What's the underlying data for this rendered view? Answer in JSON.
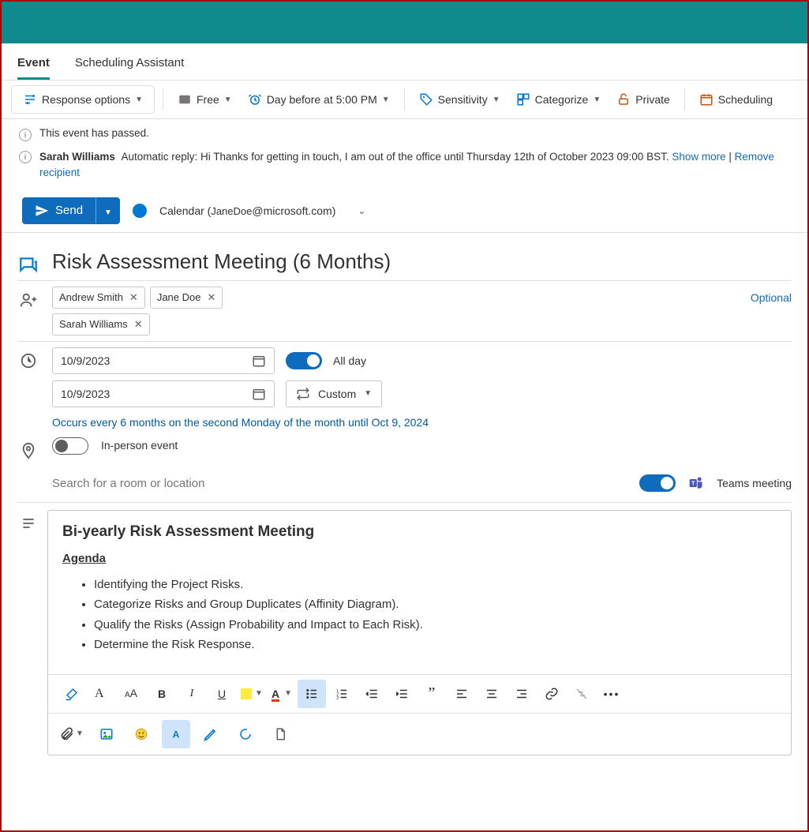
{
  "tabs": {
    "event": "Event",
    "scheduling": "Scheduling Assistant"
  },
  "toolbar": {
    "response": "Response options",
    "busy": "Free",
    "reminder": "Day before at 5:00 PM",
    "sensitivity": "Sensitivity",
    "categorize": "Categorize",
    "private": "Private",
    "scheduling": "Scheduling"
  },
  "banners": {
    "passed": "This event has passed.",
    "auto_reply_name": "Sarah Williams",
    "auto_reply_text": "Automatic reply: Hi Thanks for getting in touch, I am out of the office until Thursday 12th of October 2023 09:00 BST.",
    "show_more": "Show more",
    "sep": " | ",
    "remove": "Remove recipient"
  },
  "send": {
    "label": "Send",
    "calendar_prefix": "Calendar (",
    "calendar_user": "JaneDoe",
    "calendar_suffix": "@microsoft.com)"
  },
  "title": "Risk Assessment Meeting (6 Months)",
  "attendees": {
    "required": [
      "Andrew Smith",
      "Jane Doe"
    ],
    "second_row": [
      "Sarah Williams"
    ],
    "optional_label": "Optional"
  },
  "dates": {
    "start": "10/9/2023",
    "end": "10/9/2023",
    "all_day": "All day",
    "recur_btn": "Custom",
    "recurrence": "Occurs every 6 months on the second Monday of the month until Oct 9, 2024"
  },
  "location": {
    "inperson": "In-person event",
    "placeholder": "Search for a room or location",
    "teams": "Teams meeting"
  },
  "description": {
    "heading": "Bi-yearly Risk Assessment Meeting",
    "agenda_label": "Agenda",
    "items": [
      "Identifying the Project Risks.",
      "Categorize Risks and Group Duplicates (Affinity Diagram).",
      "Qualify the Risks (Assign Probability and Impact to Each Risk).",
      "Determine the Risk Response."
    ]
  }
}
